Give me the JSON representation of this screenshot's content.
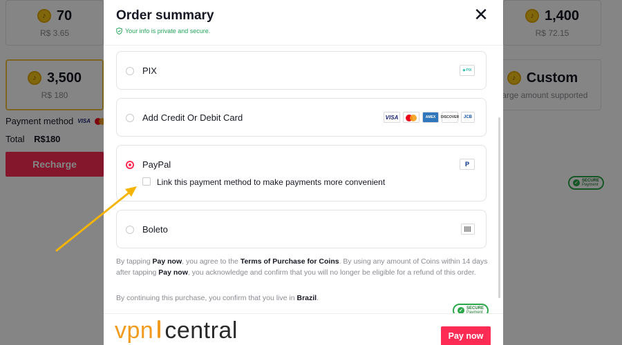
{
  "background": {
    "cards": [
      {
        "amount": "70",
        "price": "R$ 3.65"
      },
      {
        "amount": "1,400",
        "price": "R$ 72.15"
      },
      {
        "amount": "3,500",
        "price": "R$ 180"
      },
      {
        "amount": "Custom",
        "price": "Large amount supported"
      }
    ],
    "payment_method_label": "Payment method",
    "total_label": "Total",
    "total_value": "R$180",
    "recharge_label": "Recharge",
    "secure_text": "SECURE",
    "secure_sub": "Payment"
  },
  "modal": {
    "title": "Order summary",
    "privacy_note": "Your info is private and secure.",
    "close_symbol": "✕",
    "methods": [
      {
        "label": "PIX",
        "selected": false
      },
      {
        "label": "Add Credit Or Debit Card",
        "selected": false
      },
      {
        "label": "PayPal",
        "selected": true
      },
      {
        "label": "Boleto",
        "selected": false
      }
    ],
    "paypal_link_option": "Link this payment method to make payments more convenient",
    "terms": {
      "p1_a": "By tapping ",
      "p1_b": "Pay now",
      "p1_c": ", you agree to the ",
      "p1_d": "Terms of Purchase for Coins",
      "p1_e": ". By using any amount of Coins within 14 days after tapping ",
      "p1_f": "Pay now",
      "p1_g": ", you acknowledge and confirm that you will no longer be eligible for a refund of this order.",
      "p2_a": "By continuing this purchase, you confirm that you live in ",
      "p2_b": "Brazil",
      "p2_c": "."
    },
    "pay_now_label": "Pay now",
    "secure_text": "SECURE",
    "secure_sub": "Payment"
  },
  "logos": {
    "visa": "VISA",
    "amex": "AMEX",
    "discover": "DISCOVER",
    "jcb": "JCB",
    "pix": "PIX",
    "paypal": "P"
  },
  "watermark": {
    "vpn": "vpn",
    "central": "central"
  },
  "colors": {
    "accent": "#fe2c55",
    "secure_green": "#25a45b",
    "arrow": "#f5b400",
    "watermark_orange": "#f29a1d"
  }
}
